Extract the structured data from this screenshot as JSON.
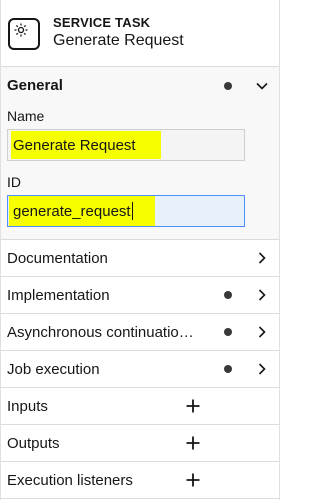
{
  "header": {
    "type": "SERVICE TASK",
    "name": "Generate Request",
    "icon": "service-task-gear-icon"
  },
  "general": {
    "title": "General",
    "name_label": "Name",
    "name_value": "Generate Request",
    "id_label": "ID",
    "id_value": "generate_request"
  },
  "groups": {
    "documentation": "Documentation",
    "implementation": "Implementation",
    "async": "Asynchronous continuatio…",
    "job": "Job execution",
    "inputs": "Inputs",
    "outputs": "Outputs",
    "listeners": "Execution listeners"
  },
  "colors": {
    "highlight": "#f6ff00",
    "focus_border": "#4d90fe",
    "dot": "#393939"
  }
}
